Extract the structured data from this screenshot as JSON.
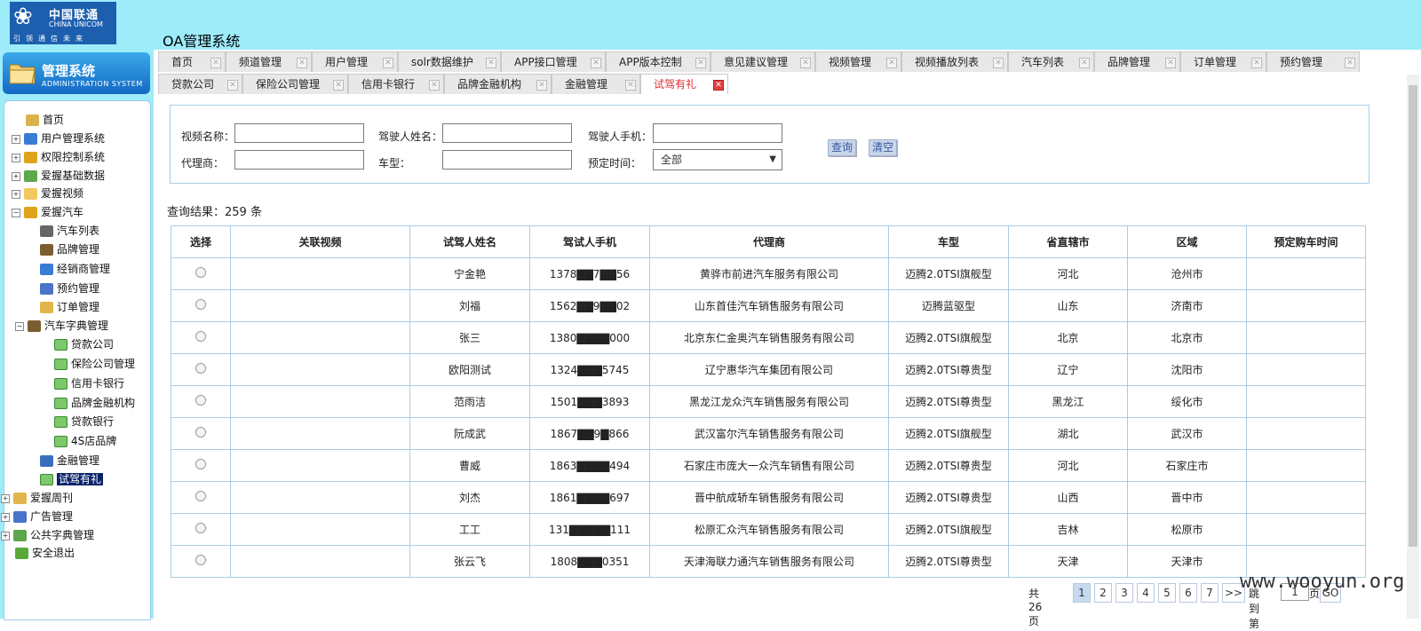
{
  "header": {
    "logo_cn": "中国联通",
    "logo_en": "CHINA UNICOM",
    "logo_slogan": "引领通信未来",
    "app_title": "OA管理系统"
  },
  "sidebar": {
    "title": "管理系统",
    "subtitle": "ADMINISTRATION SYSTEM",
    "items": [
      {
        "label": "首页",
        "icon": "home-icon",
        "expander": ""
      },
      {
        "label": "用户管理系统",
        "icon": "users-icon",
        "expander": "+"
      },
      {
        "label": "权限控制系统",
        "icon": "lock-icon",
        "expander": "+"
      },
      {
        "label": "爱握基础数据",
        "icon": "database-icon",
        "expander": "+"
      },
      {
        "label": "爱握视频",
        "icon": "folder-icon",
        "expander": "+"
      },
      {
        "label": "爱握汽车",
        "icon": "lock-icon",
        "expander": "−"
      },
      {
        "label": "汽车列表",
        "icon": "document-icon",
        "expander": ""
      },
      {
        "label": "品牌管理",
        "icon": "org-chart-icon",
        "expander": ""
      },
      {
        "label": "经销商管理",
        "icon": "users-icon",
        "expander": ""
      },
      {
        "label": "预约管理",
        "icon": "gear-icon",
        "expander": ""
      },
      {
        "label": "订单管理",
        "icon": "book-icon",
        "expander": ""
      },
      {
        "label": "汽车字典管理",
        "icon": "org-chart-icon",
        "expander": "−"
      },
      {
        "label": "贷款公司",
        "icon": "window-icon",
        "expander": ""
      },
      {
        "label": "保险公司管理",
        "icon": "window-icon",
        "expander": ""
      },
      {
        "label": "信用卡银行",
        "icon": "window-icon",
        "expander": ""
      },
      {
        "label": "品牌金融机构",
        "icon": "window-icon",
        "expander": ""
      },
      {
        "label": "贷款银行",
        "icon": "window-icon",
        "expander": ""
      },
      {
        "label": "4S店品牌",
        "icon": "window-icon",
        "expander": ""
      },
      {
        "label": "金融管理",
        "icon": "monitor-icon",
        "expander": ""
      },
      {
        "label": "试驾有礼",
        "icon": "window-icon",
        "expander": "",
        "selected": true
      },
      {
        "label": "爱握周刊",
        "icon": "book-icon",
        "expander": "+"
      },
      {
        "label": "广告管理",
        "icon": "gear-icon",
        "expander": "+"
      },
      {
        "label": "公共字典管理",
        "icon": "database-icon",
        "expander": "+"
      },
      {
        "label": "安全退出",
        "icon": "exit-icon",
        "expander": ""
      }
    ]
  },
  "tabs_row1": [
    "首页",
    "频道管理",
    "用户管理",
    "solr数据维护",
    "APP接口管理",
    "APP版本控制",
    "意见建议管理",
    "视频管理",
    "视频播放列表",
    "汽车列表",
    "品牌管理",
    "订单管理",
    "预约管理"
  ],
  "tabs_row2": [
    "贷款公司",
    "保险公司管理",
    "信用卡银行",
    "品牌金融机构",
    "金融管理",
    "试驾有礼"
  ],
  "active_tab": "试驾有礼",
  "search": {
    "video_name_label": "视频名称：",
    "driver_name_label": "驾驶人姓名：",
    "driver_phone_label": "驾驶人手机：",
    "agent_label": "代理商：",
    "model_label": "车型：",
    "reserve_time_label": "预定时间：",
    "reserve_time_value": "全部",
    "query_button": "查询",
    "clear_button": "清空"
  },
  "result_text": "查询结果：259 条",
  "table": {
    "headers": [
      "选择",
      "关联视频",
      "试驾人姓名",
      "驾试人手机",
      "代理商",
      "车型",
      "省直辖市",
      "区域",
      "预定购车时间"
    ],
    "rows": [
      [
        "",
        "",
        "宁金艳",
        "1378▇▇7▇▇56",
        "黄骅市前进汽车服务有限公司",
        "迈腾2.0TSI旗舰型",
        "河北",
        "沧州市",
        ""
      ],
      [
        "",
        "",
        "刘福",
        "1562▇▇9▇▇02",
        "山东首佳汽车销售服务有限公司",
        "迈腾蓝驱型",
        "山东",
        "济南市",
        ""
      ],
      [
        "",
        "",
        "张三",
        "1380▇▇▇▇000",
        "北京东仁金奥汽车销售服务有限公司",
        "迈腾2.0TSI旗舰型",
        "北京",
        "北京市",
        ""
      ],
      [
        "",
        "",
        "欧阳测试",
        "1324▇▇▇5745",
        "辽宁惠华汽车集团有限公司",
        "迈腾2.0TSI尊贵型",
        "辽宁",
        "沈阳市",
        ""
      ],
      [
        "",
        "",
        "范雨洁",
        "1501▇▇▇3893",
        "黑龙江龙众汽车销售服务有限公司",
        "迈腾2.0TSI尊贵型",
        "黑龙江",
        "绥化市",
        ""
      ],
      [
        "",
        "",
        "阮成武",
        "1867▇▇9▇866",
        "武汉富尔汽车销售服务有限公司",
        "迈腾2.0TSI旗舰型",
        "湖北",
        "武汉市",
        ""
      ],
      [
        "",
        "",
        "曹威",
        "1863▇▇▇▇494",
        "石家庄市庞大一众汽车销售有限公司",
        "迈腾2.0TSI尊贵型",
        "河北",
        "石家庄市",
        ""
      ],
      [
        "",
        "",
        "刘杰",
        "1861▇▇▇▇697",
        "晋中航成轿车销售服务有限公司",
        "迈腾2.0TSI尊贵型",
        "山西",
        "晋中市",
        ""
      ],
      [
        "",
        "",
        "工工",
        "131▇▇▇▇▇111",
        "松原汇众汽车销售服务有限公司",
        "迈腾2.0TSI旗舰型",
        "吉林",
        "松原市",
        ""
      ],
      [
        "",
        "",
        "张云飞",
        "1808▇▇▇0351",
        "天津海联力通汽车销售服务有限公司",
        "迈腾2.0TSI尊贵型",
        "天津",
        "天津市",
        ""
      ]
    ]
  },
  "pager": {
    "total": "共26页",
    "pages": [
      "1",
      "2",
      "3",
      "4",
      "5",
      "6",
      "7"
    ],
    "current": "1",
    "next": ">>",
    "goto_label": "跳到第",
    "goto_value": "1",
    "page_suffix": "页",
    "go_button": "GO"
  },
  "watermark": "www.wooyun.org"
}
